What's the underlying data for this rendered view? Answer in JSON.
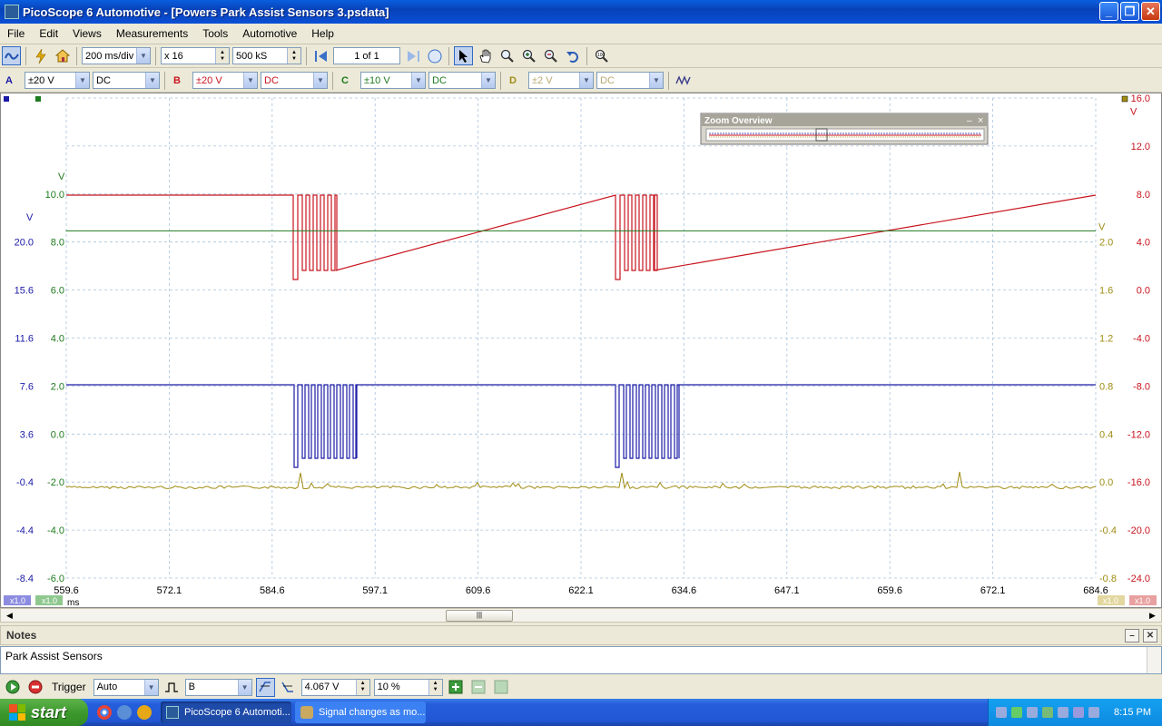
{
  "window": {
    "title": "PicoScope 6 Automotive - [Powers Park Assist Sensors 3.psdata]",
    "minimize": "_",
    "restore": "❐",
    "close": "✕"
  },
  "menu": [
    "File",
    "Edit",
    "Views",
    "Measurements",
    "Tools",
    "Automotive",
    "Help"
  ],
  "toolbar": {
    "timebase": "200 ms/div",
    "zoom": "x 16",
    "samples": "500 kS",
    "page": "1 of 1"
  },
  "channels": [
    {
      "name": "A",
      "range": "±20 V",
      "coupling": "DC",
      "color": "#1a1aa6"
    },
    {
      "name": "B",
      "range": "±20 V",
      "coupling": "DC",
      "color": "#c8141e"
    },
    {
      "name": "C",
      "range": "±10 V",
      "coupling": "DC",
      "color": "#1e7a1e"
    },
    {
      "name": "D",
      "range": "±2 V",
      "coupling": "DC",
      "color": "#a08c14"
    }
  ],
  "scope": {
    "unit_v": "V",
    "time_unit": "ms",
    "x_ticks": [
      "559.6",
      "572.1",
      "584.6",
      "597.1",
      "609.6",
      "622.1",
      "634.6",
      "647.1",
      "659.6",
      "672.1",
      "684.6"
    ],
    "axis_a": [
      "20.0",
      "15.6",
      "11.6",
      "7.6",
      "3.6",
      "-0.4",
      "-4.4",
      "-8.4"
    ],
    "axis_c": [
      "10.0",
      "8.0",
      "6.0",
      "4.0",
      "2.0",
      "0.0",
      "-2.0",
      "-4.0",
      "-6.0"
    ],
    "axis_d": [
      "2.0",
      "1.6",
      "1.2",
      "0.8",
      "0.4",
      "0.0",
      "-0.4",
      "-0.8"
    ],
    "axis_b": [
      "16.0",
      "12.0",
      "8.0",
      "4.0",
      "0.0",
      "-4.0",
      "-8.0",
      "-12.0",
      "-16.0",
      "-20.0",
      "-24.0"
    ],
    "scale_badges": [
      "x1.0",
      "x1.0",
      "x1.0",
      "x1.0"
    ],
    "zoom_overview_title": "Zoom Overview",
    "zoom_overview_close": "×"
  },
  "notes": {
    "header": "Notes",
    "text": "Park Assist Sensors"
  },
  "bottom": {
    "trigger_label": "Trigger",
    "trigger_mode": "Auto",
    "trigger_channel": "B",
    "trigger_level": "4.067 V",
    "pretrigger": "10 %"
  },
  "taskbar": {
    "start": "start",
    "items": [
      "PicoScope 6 Automoti...",
      "Signal changes as mo..."
    ],
    "clock": "8:15 PM"
  }
}
